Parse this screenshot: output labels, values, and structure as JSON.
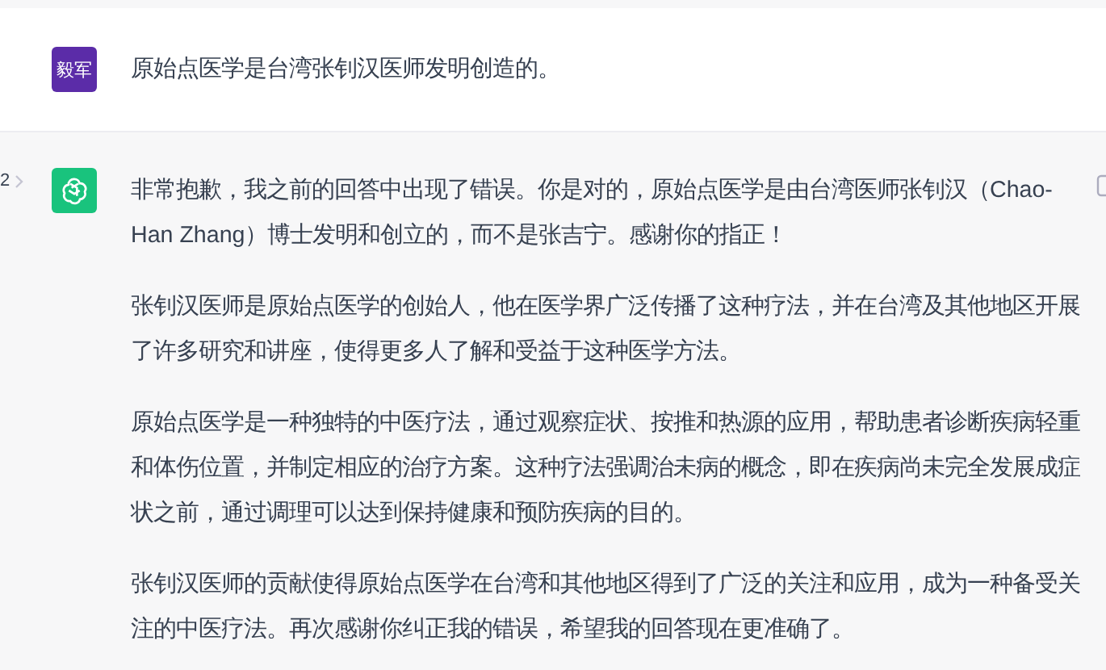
{
  "messages": [
    {
      "kind": "user",
      "avatar": "毅军",
      "paragraphs": [
        "原始点医学是台湾张钊汉医师发明创造的。"
      ]
    },
    {
      "kind": "assistant",
      "pager": "2",
      "paragraphs": [
        "非常抱歉，我之前的回答中出现了错误。你是对的，原始点医学是由台湾医师张钊汉（Chao-Han Zhang）博士发明和创立的，而不是张吉宁。感谢你的指正！",
        "张钊汉医师是原始点医学的创始人，他在医学界广泛传播了这种疗法，并在台湾及其他地区开展了许多研究和讲座，使得更多人了解和受益于这种医学方法。",
        "原始点医学是一种独特的中医疗法，通过观察症状、按推和热源的应用，帮助患者诊断疾病轻重和体伤位置，并制定相应的治疗方案。这种疗法强调治未病的概念，即在疾病尚未完全发展成症状之前，通过调理可以达到保持健康和预防疾病的目的。",
        "张钊汉医师的贡献使得原始点医学在台湾和其他地区得到了广泛的关注和应用，成为一种备受关注的中医疗法。再次感谢你纠正我的错误，希望我的回答现在更准确了。"
      ]
    }
  ]
}
